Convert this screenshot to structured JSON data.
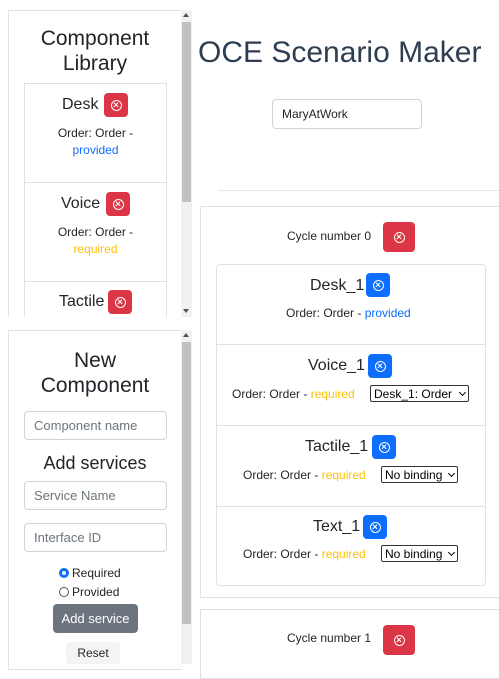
{
  "library": {
    "title_line1": "Component",
    "title_line2": "Library",
    "items": [
      {
        "name": "Desk",
        "order_prefix": "Order: Order -",
        "kind": "provided"
      },
      {
        "name": "Voice",
        "order_prefix": "Order: Order -",
        "kind": "required"
      },
      {
        "name": "Tactile"
      }
    ]
  },
  "new_component": {
    "title_line1": "New",
    "title_line2": "Component",
    "name_placeholder": "Component name",
    "services_heading": "Add services",
    "service_placeholder": "Service Name",
    "interface_placeholder": "Interface ID",
    "radio_required": "Required",
    "radio_provided": "Provided",
    "add_service_label": "Add service",
    "reset_label": "Reset"
  },
  "main": {
    "title": "OCE Scenario Maker",
    "scenario_name": "MaryAtWork",
    "cycles": [
      {
        "label": "Cycle number 0",
        "components": [
          {
            "name": "Desk_1",
            "order_prefix": "Order: Order -",
            "kind": "provided"
          },
          {
            "name": "Voice_1",
            "order_prefix": "Order: Order -",
            "kind": "required",
            "binding": "Desk_1: Order"
          },
          {
            "name": "Tactile_1",
            "order_prefix": "Order: Order -",
            "kind": "required",
            "binding": "No binding"
          },
          {
            "name": "Text_1",
            "order_prefix": "Order: Order -",
            "kind": "required",
            "binding": "No binding"
          }
        ]
      },
      {
        "label": "Cycle number 1"
      }
    ]
  },
  "colors": {
    "danger": "#dc3545",
    "primary": "#0d6efd",
    "warning": "#ffc107",
    "secondary": "#6c757d"
  }
}
